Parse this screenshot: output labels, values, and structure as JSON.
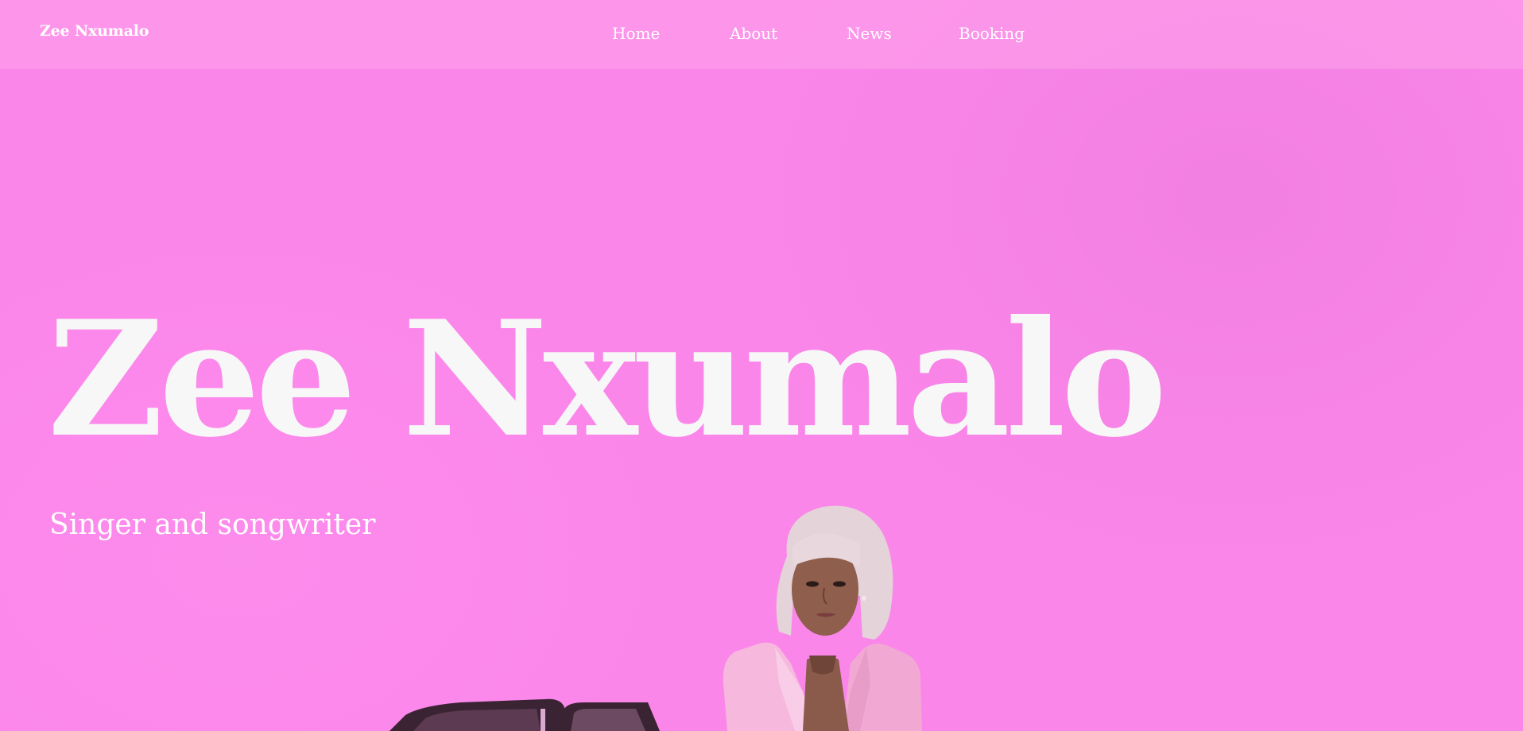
{
  "nav": {
    "brand": "Zee Nxumalo",
    "links": [
      {
        "label": "Home"
      },
      {
        "label": "About"
      },
      {
        "label": "News"
      },
      {
        "label": "Booking"
      }
    ]
  },
  "hero": {
    "title": "Zee Nxumalo",
    "subtitle": "Singer and songwriter",
    "image": "artist-portrait-with-car"
  },
  "colors": {
    "background": "#fb86ea",
    "nav_bar": "#fda8ef",
    "title": "#f7f7f7",
    "text": "#ffffff"
  }
}
